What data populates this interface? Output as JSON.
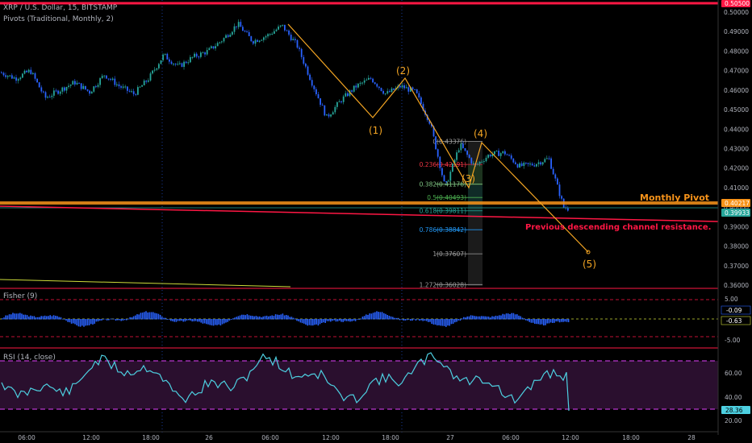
{
  "header": {
    "symbol_line": "XRP / U.S. Dollar, 15, BITSTAMP",
    "pivots_line": "Pivots (Traditional, Monthly, 2)"
  },
  "annotations": {
    "monthly_pivot": "Monthly Pivot",
    "channel_note": "Previous descending channel resistance.",
    "waves": [
      "(1)",
      "(2)",
      "(3)",
      "(4)",
      "(5)"
    ]
  },
  "fib_levels": [
    {
      "ratio": "0",
      "value": "0.43376",
      "label": "0(0.43376)",
      "color": "#9e9e9e"
    },
    {
      "ratio": "0.236",
      "value": "0.42191",
      "label": "0.236(0.42191)",
      "color": "#f23645"
    },
    {
      "ratio": "0.382",
      "value": "0.41176",
      "label": "0.382(0.41176)",
      "color": "#81c784"
    },
    {
      "ratio": "0.5",
      "value": "0.40493",
      "label": "0.5(0.40493)",
      "color": "#4caf50"
    },
    {
      "ratio": "0.618",
      "value": "0.39811",
      "label": "0.618(0.39811)",
      "color": "#26a69a"
    },
    {
      "ratio": "0.786",
      "value": "0.38842",
      "label": "0.786(0.38842)",
      "color": "#2196f3"
    },
    {
      "ratio": "1",
      "value": "0.37607",
      "label": "1(0.37607)",
      "color": "#9e9e9e"
    },
    {
      "ratio": "1.272",
      "value": "0.36028",
      "label": "1.272(0.36028)",
      "color": "#9e9e9e"
    }
  ],
  "price_axis": {
    "ticks": [
      "0.50000",
      "0.49000",
      "0.48000",
      "0.47000",
      "0.46000",
      "0.45000",
      "0.44000",
      "0.43000",
      "0.42000",
      "0.41000",
      "0.40000",
      "0.39000",
      "0.38000",
      "0.37000",
      "0.36000"
    ],
    "top_tag": "0.50500",
    "pivot_tag": "0.40217",
    "last_tag": "0.39933"
  },
  "time_axis": {
    "ticks": [
      "06:00",
      "12:00",
      "18:00",
      "26",
      "06:00",
      "12:00",
      "18:00",
      "27",
      "06:00",
      "12:00",
      "18:00",
      "28"
    ]
  },
  "fisher": {
    "label": "Fisher (9)",
    "ticks": [
      "5.00",
      "-5.00"
    ],
    "tag_a": "-0.09",
    "tag_b": "-0.63"
  },
  "rsi": {
    "label": "RSI (14, close)",
    "ticks": [
      "60.00",
      "40.00",
      "20.00"
    ],
    "tag": "28.36"
  },
  "colors": {
    "up": "#26a69a",
    "down": "#2962ff",
    "pivot": "#f7931a",
    "resistance": "#ff1744",
    "wave": "#f5a623",
    "rsi_line": "#4dd0e1",
    "rsi_band": "#2a0f2e",
    "fisher_bar": "#2962ff"
  },
  "chart_data": {
    "type": "candlestick",
    "symbol": "XRP / U.S. Dollar",
    "interval": "15",
    "exchange": "BITSTAMP",
    "ylim": [
      0.36,
      0.506
    ],
    "close_path": [
      {
        "x": 0.0,
        "y": 0.469
      },
      {
        "x": 0.5,
        "y": 0.466
      },
      {
        "x": 1.0,
        "y": 0.47
      },
      {
        "x": 1.5,
        "y": 0.456
      },
      {
        "x": 2.0,
        "y": 0.46
      },
      {
        "x": 2.5,
        "y": 0.464
      },
      {
        "x": 3.0,
        "y": 0.459
      },
      {
        "x": 3.5,
        "y": 0.468
      },
      {
        "x": 4.0,
        "y": 0.462
      },
      {
        "x": 4.5,
        "y": 0.458
      },
      {
        "x": 5.0,
        "y": 0.466
      },
      {
        "x": 5.5,
        "y": 0.478
      },
      {
        "x": 6.0,
        "y": 0.472
      },
      {
        "x": 6.5,
        "y": 0.477
      },
      {
        "x": 7.0,
        "y": 0.48
      },
      {
        "x": 7.5,
        "y": 0.486
      },
      {
        "x": 8.0,
        "y": 0.494
      },
      {
        "x": 8.5,
        "y": 0.485
      },
      {
        "x": 9.0,
        "y": 0.488
      },
      {
        "x": 9.5,
        "y": 0.493
      },
      {
        "x": 10.0,
        "y": 0.483
      },
      {
        "x": 10.5,
        "y": 0.464
      },
      {
        "x": 11.0,
        "y": 0.446
      },
      {
        "x": 11.5,
        "y": 0.455
      },
      {
        "x": 12.0,
        "y": 0.462
      },
      {
        "x": 12.5,
        "y": 0.466
      },
      {
        "x": 13.0,
        "y": 0.458
      },
      {
        "x": 13.5,
        "y": 0.462
      },
      {
        "x": 14.0,
        "y": 0.459
      },
      {
        "x": 14.5,
        "y": 0.443
      },
      {
        "x": 15.0,
        "y": 0.41
      },
      {
        "x": 15.5,
        "y": 0.432
      },
      {
        "x": 16.0,
        "y": 0.421
      },
      {
        "x": 16.5,
        "y": 0.427
      },
      {
        "x": 17.0,
        "y": 0.428
      },
      {
        "x": 17.5,
        "y": 0.421
      },
      {
        "x": 18.0,
        "y": 0.422
      },
      {
        "x": 18.5,
        "y": 0.425
      },
      {
        "x": 19.0,
        "y": 0.4
      },
      {
        "x": 19.2,
        "y": 0.399
      }
    ],
    "waves": [
      {
        "label": "(1)",
        "price": 0.446
      },
      {
        "label": "(2)",
        "price": 0.466
      },
      {
        "label": "(3)",
        "price": 0.41
      },
      {
        "label": "(4)",
        "price": 0.434
      },
      {
        "label": "(5)",
        "price": 0.376
      }
    ],
    "monthly_pivot": 0.40217,
    "last_price": 0.39933
  }
}
